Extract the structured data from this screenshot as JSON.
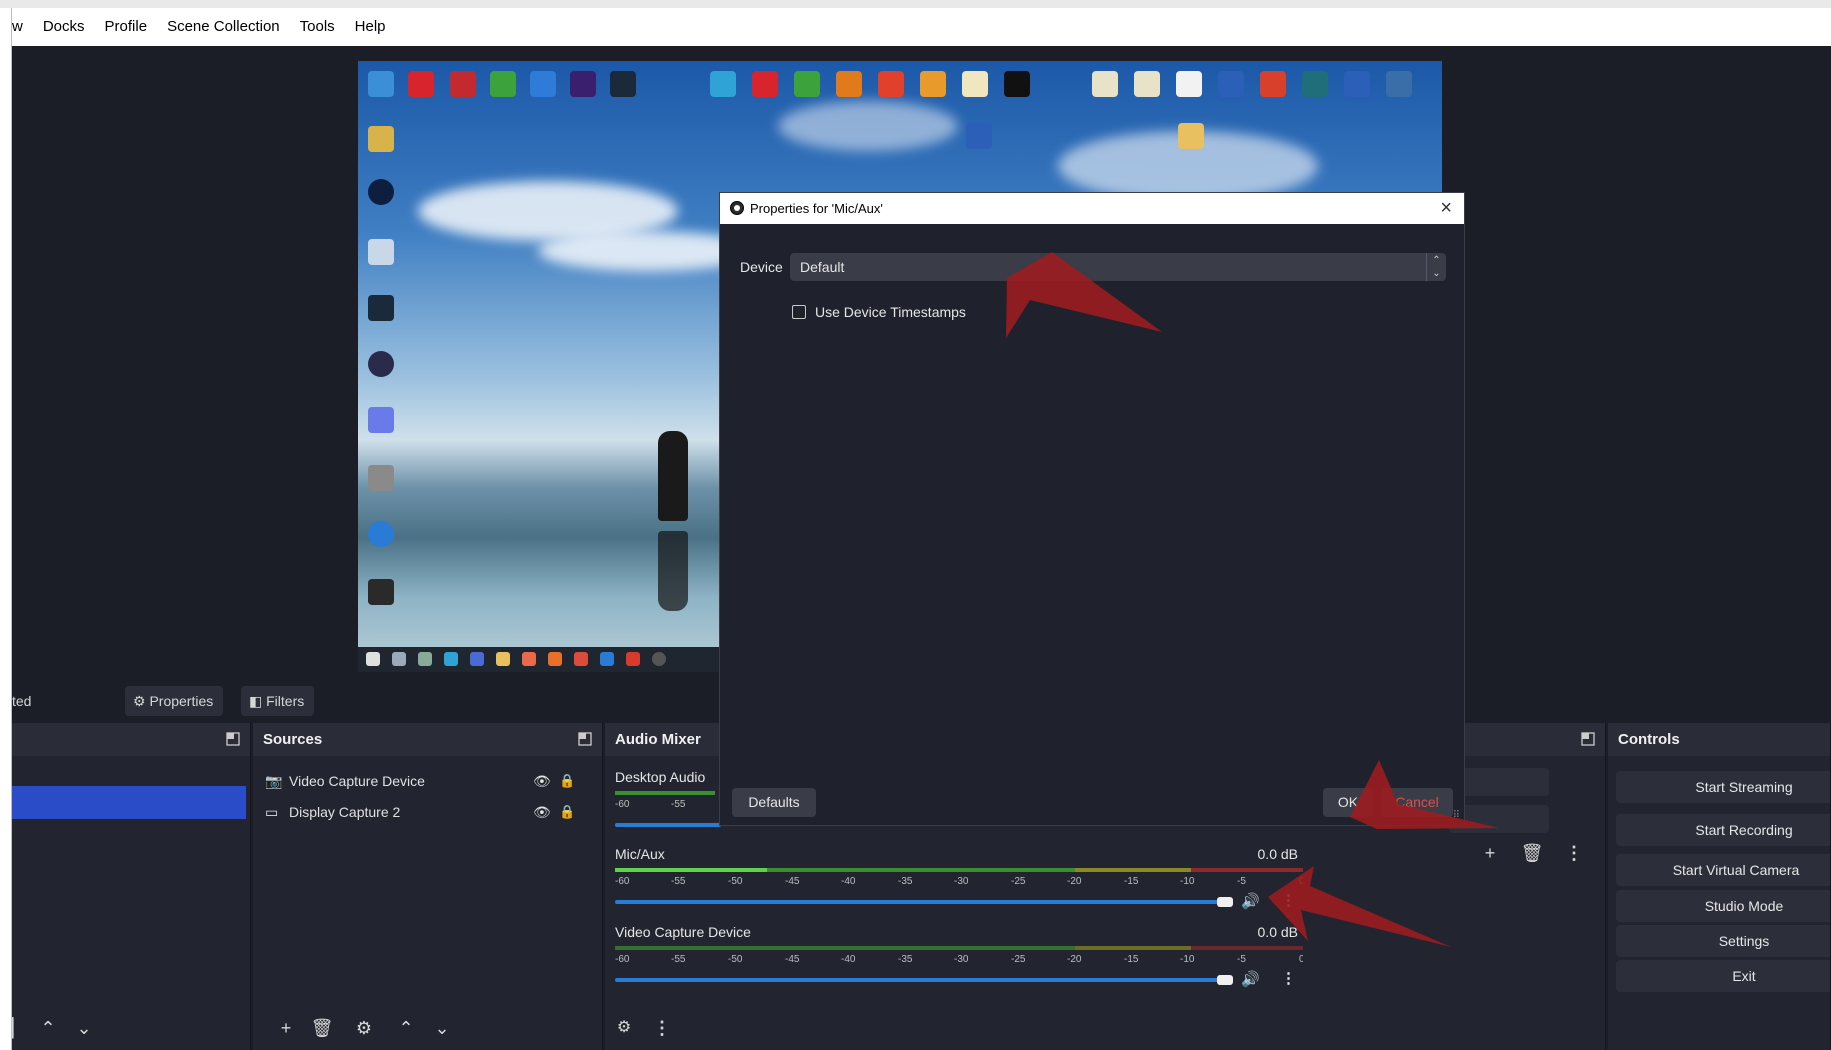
{
  "menubar": {
    "items": [
      {
        "label": "w"
      },
      {
        "label": "Docks"
      },
      {
        "label": "Profile"
      },
      {
        "label": "Scene Collection"
      },
      {
        "label": "Tools"
      },
      {
        "label": "Help"
      }
    ]
  },
  "dialog": {
    "title": "Properties for 'Mic/Aux'",
    "device_label": "Device",
    "device_value": "Default",
    "timestamps_label": "Use Device Timestamps",
    "timestamps_checked": false,
    "defaults_label": "Defaults",
    "ok_label": "OK",
    "cancel_label": "Cancel"
  },
  "context_bar": {
    "status_text": "ted",
    "properties_label": "Properties",
    "filters_label": "Filters"
  },
  "sources": {
    "title": "Sources",
    "items": [
      {
        "label": "Video Capture Device",
        "icon": "camera-icon"
      },
      {
        "label": "Display Capture 2",
        "icon": "monitor-icon"
      }
    ]
  },
  "mixer": {
    "title": "Audio Mixer",
    "scale_ticks": [
      "-60",
      "-55",
      "-50",
      "-45",
      "-40",
      "-35",
      "-30",
      "-25",
      "-20",
      "-15",
      "-10",
      "-5",
      "0"
    ],
    "channels": [
      {
        "name": "Desktop Audio",
        "db": "",
        "visible_ticks": [
          "-60",
          "-55"
        ]
      },
      {
        "name": "Mic/Aux",
        "db": "0.0 dB",
        "level": 0.22
      },
      {
        "name": "Video Capture Device",
        "db": "0.0 dB",
        "level": 0
      }
    ]
  },
  "controls": {
    "title": "Controls",
    "buttons": [
      "Start Streaming",
      "Start Recording",
      "Start Virtual Camera",
      "Studio Mode",
      "Settings",
      "Exit"
    ]
  },
  "colors": {
    "app_bg": "#1b1e27",
    "dock_bg": "#22252f",
    "selection_blue": "#2a4cc8",
    "volume_blue": "#2a7bd6",
    "cancel_red": "#e24c4c",
    "arrow_red": "#a0161c"
  }
}
